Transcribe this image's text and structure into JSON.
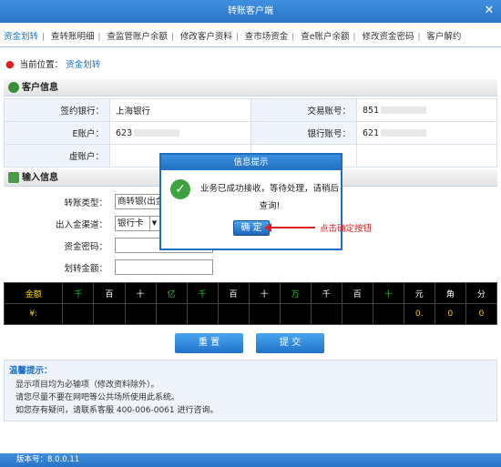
{
  "window": {
    "title": "转账客户端",
    "close_glyph": "✕"
  },
  "tabs": [
    "资金划转",
    "查转账明细",
    "查监管账户余额",
    "修改客户资料",
    "查市场资金",
    "查e账户余额",
    "修改资金密码",
    "客户解约"
  ],
  "location": {
    "label": "当前位置：",
    "value": "资金划转"
  },
  "customer": {
    "heading": "客户信息",
    "sign_bank_label": "签约银行：",
    "sign_bank_value": "上海银行",
    "trade_acct_label": "交易账号：",
    "trade_acct_value": "851",
    "e_acct_label": "E账户：",
    "e_acct_value": "623",
    "bank_acct_label": "银行账号：",
    "bank_acct_value": "621",
    "virtual_acct_label": "虚账户："
  },
  "input_section": {
    "heading": "输入信息",
    "transfer_type_label": "转账类型：",
    "transfer_type_value": "商转银(出金)",
    "channel_label": "出入金渠道：",
    "channel_value": "银行卡",
    "password_label": "资金密码：",
    "amount_label": "划转金额："
  },
  "amount_grid": {
    "caption_top": "金额",
    "caption_bottom": "¥:",
    "units": [
      "千",
      "百",
      "十",
      "亿",
      "千",
      "百",
      "十",
      "万",
      "千",
      "百",
      "十",
      "元",
      "角",
      "分"
    ],
    "values": [
      "",
      "",
      "",
      "",
      "",
      "",
      "",
      "",
      "",
      "",
      "",
      "0.",
      "0",
      "0"
    ]
  },
  "buttons": {
    "reset": "重 置",
    "submit": "提 交"
  },
  "tips": {
    "title": "温馨提示：",
    "lines": [
      "显示项目均为必输项（修改资料除外）。",
      "请您尽量不要在网吧等公共场所使用此系统。",
      "如您存有疑问，请联系客服 400-006-0061 进行咨询。"
    ]
  },
  "status": {
    "version": "版本号：8.0.0.11"
  },
  "modal": {
    "title": "信息提示",
    "message": "业务已成功接收，等待处理，请稍后查询!",
    "ok": "确 定"
  },
  "annotation": {
    "text": "点击确定按钮"
  }
}
